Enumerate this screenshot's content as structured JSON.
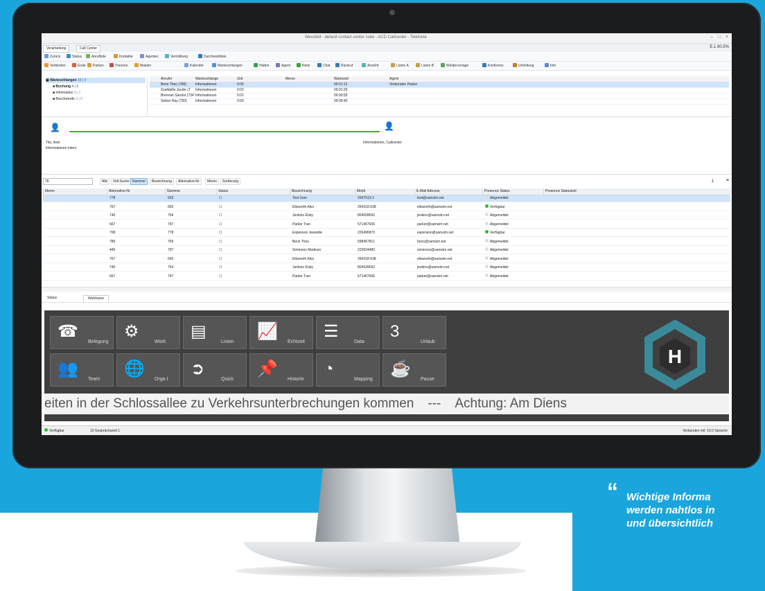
{
  "window": {
    "title": "Wendtell - default contact center suite - ACD Callcenter - Telefonie",
    "tabs": [
      "Verarbeitung",
      "Call Center"
    ],
    "right_info": "E.1 80.5%"
  },
  "toolbar1": {
    "items": [
      "Zurück",
      "Status",
      "Anrufliste",
      "Kontakte",
      "Agenten",
      "Vermittlung",
      "Durchwahlliste"
    ]
  },
  "toolbar2": {
    "items": [
      "Verbinden",
      "Ende",
      "Parken",
      "Trennen",
      "Makeln",
      "Kalender",
      "Warteschlangen",
      "Halten",
      "Agent",
      "Notiz",
      "Chat",
      "Rückruf",
      "Ansicht",
      "Listen A",
      "Listen B",
      "Wiedervorlage",
      "Konferenz",
      "Umleitung",
      "Info"
    ]
  },
  "tree": {
    "items": [
      {
        "label": "Warteschlangen",
        "count": "10 | 0"
      },
      {
        "label": "Buchung",
        "count": "4 | 2"
      },
      {
        "label": "Information",
        "count": "3 | 1"
      },
      {
        "label": "Beschwerde",
        "count": "3 | 0"
      }
    ]
  },
  "calls": {
    "headers": [
      "Anrufer",
      "Warteschlange",
      "Zeit",
      "Memo",
      "Wartezeit",
      "Agent"
    ],
    "rows": [
      [
        "Beris Theo (786)",
        "Informationen",
        "0:05",
        "",
        "00:01:12",
        "Verbunden Parker"
      ],
      [
        "Grafdaille Jackie (7",
        "Informationen",
        "0:02",
        "",
        "00:01:25",
        ""
      ],
      [
        "Brennan Sandra (734",
        "Informationen",
        "0:01",
        "",
        "00:00:55",
        ""
      ],
      [
        "Sieber Ray (783)",
        "Informationen",
        "0:00",
        "",
        "00:00:40",
        ""
      ]
    ]
  },
  "flow": {
    "left_name": "Tito, Axel",
    "left_sub": "Informationen intern",
    "right_name": "Informationen, Callcenter"
  },
  "search": {
    "value": "78",
    "tabs": [
      "Alle",
      "Voll-Suche",
      "Nummer",
      "Bezeichnung",
      "Alternative-Nr",
      "Memo",
      "Sortierung"
    ],
    "active_tab": "Nummer"
  },
  "table": {
    "headers": [
      "Memo",
      "Alternative-Nr",
      "Nummer",
      "Status",
      "Bezeichnung",
      "Mobil",
      "E-Mail Adresse",
      "Presence Status",
      "Presence Statustext"
    ],
    "rows": [
      {
        "alt": "778",
        "num": "633",
        "status": "☐",
        "name": "Test User",
        "mobil": "2647513-2",
        "email": "test@samsim.net",
        "presence": "Abgemeldet",
        "color": "#dddddd",
        "selected": true
      },
      {
        "alt": "767",
        "num": "655",
        "status": "☐",
        "name": "Ellsworth Alex",
        "mobil": "264318-038",
        "email": "ellsworth@samsim.net",
        "presence": "Verfügbar",
        "color": "#2dbb2d",
        "selected": false
      },
      {
        "alt": "740",
        "num": "754",
        "status": "☐",
        "name": "Jenkins Ruby",
        "mobil": "804928692",
        "email": "jenkins@samsim.net",
        "presence": "Abgemeldet",
        "color": "#dddddd",
        "selected": false
      },
      {
        "alt": "667",
        "num": "747",
        "status": "☐",
        "name": "Parker Tran",
        "mobil": "571467606",
        "email": "parker@samsim.net",
        "presence": "Abgemeldet",
        "color": "#dddddd",
        "selected": false
      },
      {
        "alt": "708",
        "num": "778",
        "status": "☐",
        "name": "Espenson Jeanette",
        "mobil": "226496870",
        "email": "espenson@samsim.net",
        "presence": "Verfügbar",
        "color": "#2dbb2d",
        "selected": false
      },
      {
        "alt": "786",
        "num": "769",
        "status": "☐",
        "name": "Beris Theo",
        "mobil": "598457811",
        "email": "beris@samsim.net",
        "presence": "Abgemeldet",
        "color": "#dddddd",
        "selected": false
      },
      {
        "alt": "445",
        "num": "797",
        "status": "☐",
        "name": "Simmons Madison",
        "mobil": "223624483",
        "email": "simmons@samsim.net",
        "presence": "Abgemeldet",
        "color": "#dddddd",
        "selected": false
      },
      {
        "alt": "767",
        "num": "655",
        "status": "☐",
        "name": "Ellsworth Alex",
        "mobil": "264318-038",
        "email": "ellsworth@samsim.net",
        "presence": "Abgemeldet",
        "color": "#dddddd",
        "selected": false
      },
      {
        "alt": "740",
        "num": "754",
        "status": "☐",
        "name": "Jenkins Ruby",
        "mobil": "804928692",
        "email": "jenkins@samsim.net",
        "presence": "Abgemeldet",
        "color": "#dddddd",
        "selected": false
      },
      {
        "alt": "667",
        "num": "747",
        "status": "☐",
        "name": "Parker Tran",
        "mobil": "571467606",
        "email": "parker@samsim.net",
        "presence": "Abgemeldet",
        "color": "#dddddd",
        "selected": false
      }
    ]
  },
  "bottom_tabs": [
    "Status",
    "Webframe"
  ],
  "dashboard": {
    "tiles_row1": [
      {
        "label": "Belegung",
        "icon": "person-phone-icon",
        "sym": "☎"
      },
      {
        "label": "Work",
        "icon": "gears-icon",
        "sym": "⚙"
      },
      {
        "label": "Listen",
        "icon": "folders-icon",
        "sym": "▤"
      },
      {
        "label": "Echtzeit",
        "icon": "chart-icon",
        "sym": "📈"
      },
      {
        "label": "Data",
        "icon": "database-icon",
        "sym": "☰"
      },
      {
        "label": "Urlaub",
        "icon": "calendar-icon",
        "sym": "3"
      }
    ],
    "tiles_row2": [
      {
        "label": "Team",
        "icon": "team-icon",
        "sym": "👥"
      },
      {
        "label": "Orga I",
        "icon": "globe-icon",
        "sym": "🌐"
      },
      {
        "label": "Quick",
        "icon": "exit-icon",
        "sym": "➲"
      },
      {
        "label": "Historie",
        "icon": "pin-icon",
        "sym": "📌"
      },
      {
        "label": "Mapping",
        "icon": "clock-icon",
        "sym": "◔"
      },
      {
        "label": "Pause",
        "icon": "coffee-icon",
        "sym": "☕"
      }
    ],
    "logo_letter": "H",
    "ticker_left": "eiten in der Schlossallee zu Verkehrsunterbrechungen kommen",
    "ticker_sep": "---",
    "ticker_right": "Achtung: Am Diens"
  },
  "statusbar": {
    "left": "Verfügbar",
    "mid": "10 Gesprächszeit 1",
    "right": "Verbunden mit: 10.0  Sprache"
  },
  "quote": {
    "mark": "“",
    "lines": [
      "Wichtige Informa",
      "werden nahtlos in",
      "und übersichtlich"
    ]
  },
  "colors": {
    "background_blue": "#1aa6dc",
    "selection": "#cfe4fa",
    "available_green": "#2dbb2d"
  }
}
